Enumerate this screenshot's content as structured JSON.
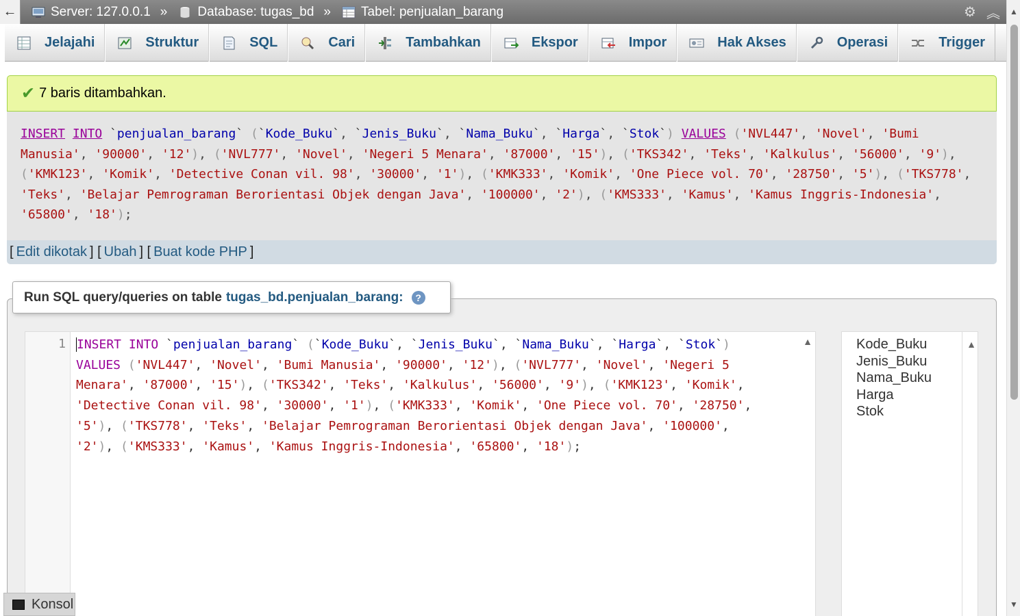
{
  "breadcrumb": {
    "server": "Server: 127.0.0.1",
    "database": "Database: tugas_bd",
    "table": "Tabel: penjualan_barang",
    "separator": "»"
  },
  "tabs": [
    {
      "label": "Jelajahi",
      "icon": "browse-icon"
    },
    {
      "label": "Struktur",
      "icon": "structure-icon"
    },
    {
      "label": "SQL",
      "icon": "sql-icon"
    },
    {
      "label": "Cari",
      "icon": "search-icon"
    },
    {
      "label": "Tambahkan",
      "icon": "insert-icon"
    },
    {
      "label": "Ekspor",
      "icon": "export-icon"
    },
    {
      "label": "Impor",
      "icon": "import-icon"
    },
    {
      "label": "Hak Akses",
      "icon": "privileges-icon"
    },
    {
      "label": "Operasi",
      "icon": "operations-icon"
    },
    {
      "label": "Trigger",
      "icon": "trigger-icon"
    }
  ],
  "success_message": "7 baris ditambahkan.",
  "links": {
    "edit_inline": "Edit dikotak",
    "edit": "Ubah",
    "create_php": "Buat kode PHP"
  },
  "query_panel": {
    "title": "Run SQL query/queries on table",
    "table_name": "tugas_bd.penjualan_barang:",
    "line_number": "1"
  },
  "columns": [
    "Kode_Buku",
    "Jenis_Buku",
    "Nama_Buku",
    "Harga",
    "Stok"
  ],
  "console_label": "Konsol",
  "colors": {
    "accent": "#235a81",
    "success_bg": "#ebf8a4",
    "keyword": "#990099",
    "string": "#aa1111",
    "identifier": "#0000aa"
  }
}
